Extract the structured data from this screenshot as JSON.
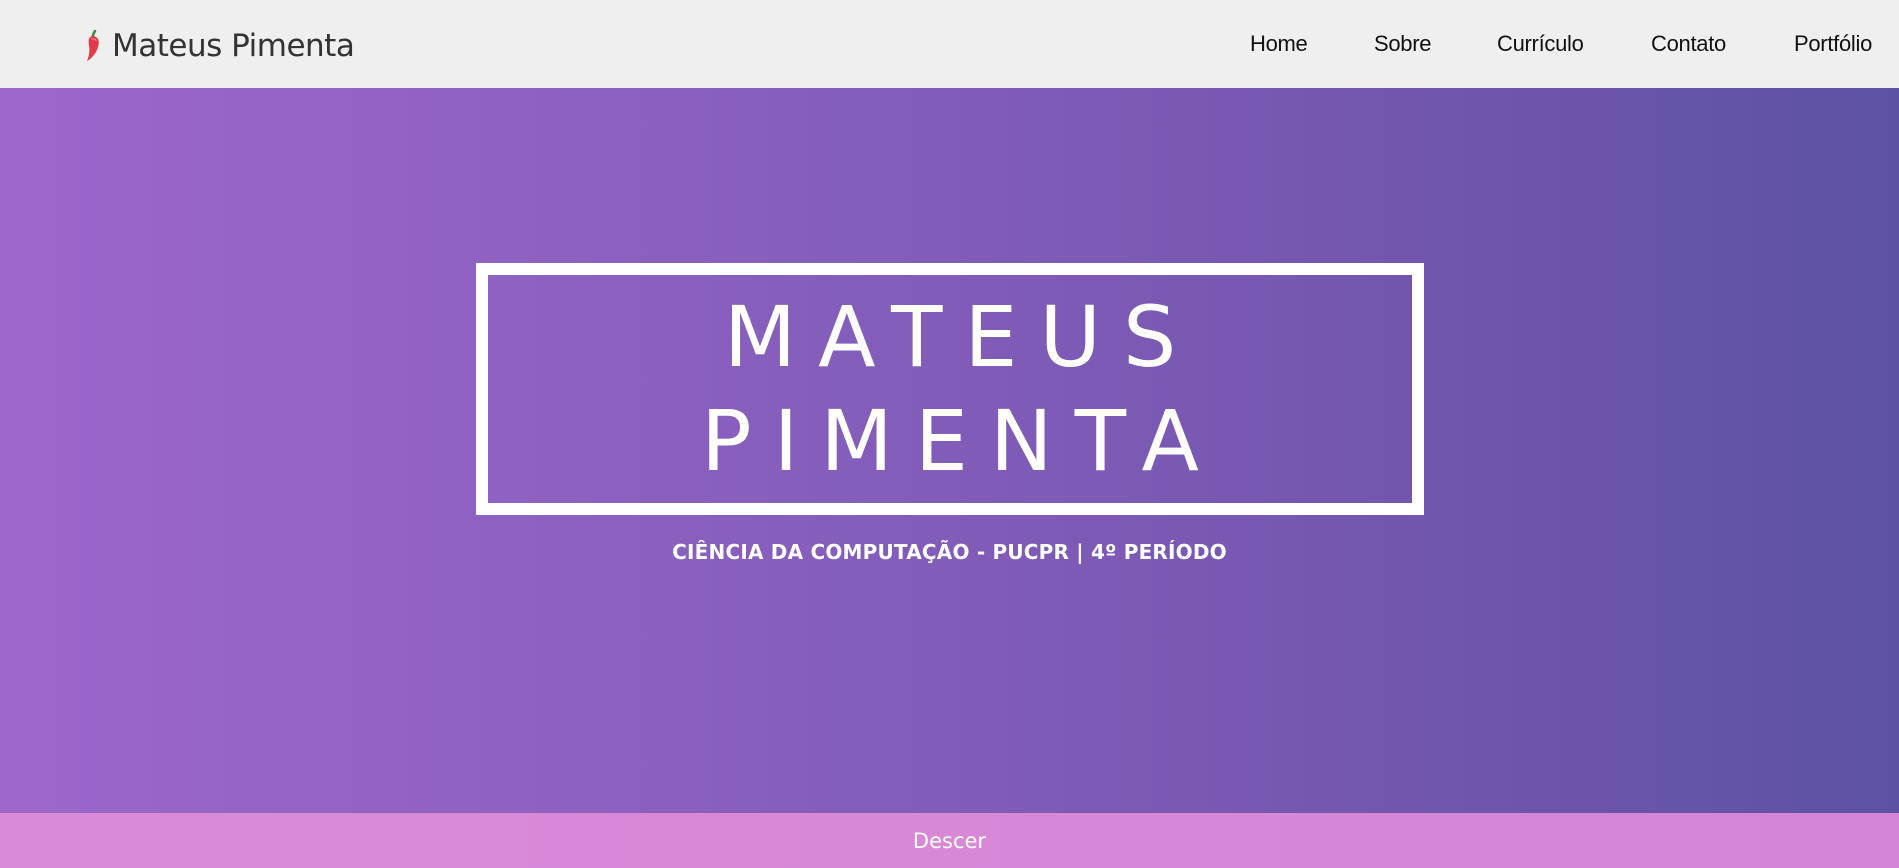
{
  "navbar": {
    "brand_text": "Mateus Pimenta",
    "brand_icon": "chili-pepper-icon",
    "items": [
      {
        "label": "Home"
      },
      {
        "label": "Sobre"
      },
      {
        "label": "Currículo"
      },
      {
        "label": "Contato"
      },
      {
        "label": "Portfólio"
      }
    ]
  },
  "hero": {
    "title_line_1": "MATEUS",
    "title_line_2": "PIMENTA",
    "subtitle": "CIÊNCIA DA COMPUTAÇÃO - PUCPR | 4º PERÍODO"
  },
  "footer": {
    "scroll_label": "Descer"
  },
  "colors": {
    "navbar_bg": "#efefef",
    "hero_gradient_start": "#9d66cb",
    "hero_gradient_end": "#5d52a2",
    "footer_bar": "#d98ad8",
    "brand_icon_red": "#e23a4a",
    "brand_icon_green": "#3a8a3a"
  }
}
